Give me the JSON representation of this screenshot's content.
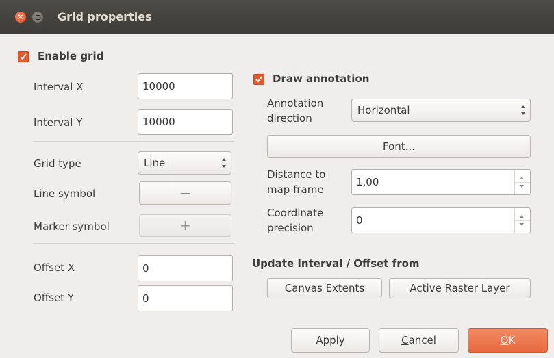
{
  "window": {
    "title": "Grid properties"
  },
  "enable_grid": {
    "label": "Enable grid",
    "checked": true
  },
  "interval": {
    "x_label": "Interval X",
    "x_value": "10000",
    "y_label": "Interval Y",
    "y_value": "10000"
  },
  "grid_type": {
    "label": "Grid type",
    "value": "Line"
  },
  "line_symbol": {
    "label": "Line symbol",
    "preview": "—"
  },
  "marker_symbol": {
    "label": "Marker symbol",
    "preview": "+"
  },
  "offset": {
    "x_label": "Offset X",
    "x_value": "0",
    "y_label": "Offset Y",
    "y_value": "0"
  },
  "draw_annotation": {
    "label": "Draw annotation",
    "checked": true
  },
  "annotation_direction": {
    "label_line1": "Annotation",
    "label_line2": "direction",
    "value": "Horizontal"
  },
  "font_button": {
    "label": "Font..."
  },
  "distance": {
    "label_line1": "Distance to",
    "label_line2": "map frame",
    "value": "1,00"
  },
  "precision": {
    "label_line1": "Coordinate",
    "label_line2": "precision",
    "value": "0"
  },
  "update": {
    "heading": "Update Interval / Offset from",
    "canvas_button": "Canvas Extents",
    "raster_button": "Active Raster Layer"
  },
  "footer": {
    "apply": "Apply",
    "cancel_first": "C",
    "cancel_rest": "ancel",
    "ok_first": "O",
    "ok_rest": "K"
  },
  "colors": {
    "accent": "#e45a2c",
    "titlebar": "#3d3b37",
    "background": "#efeeec"
  }
}
